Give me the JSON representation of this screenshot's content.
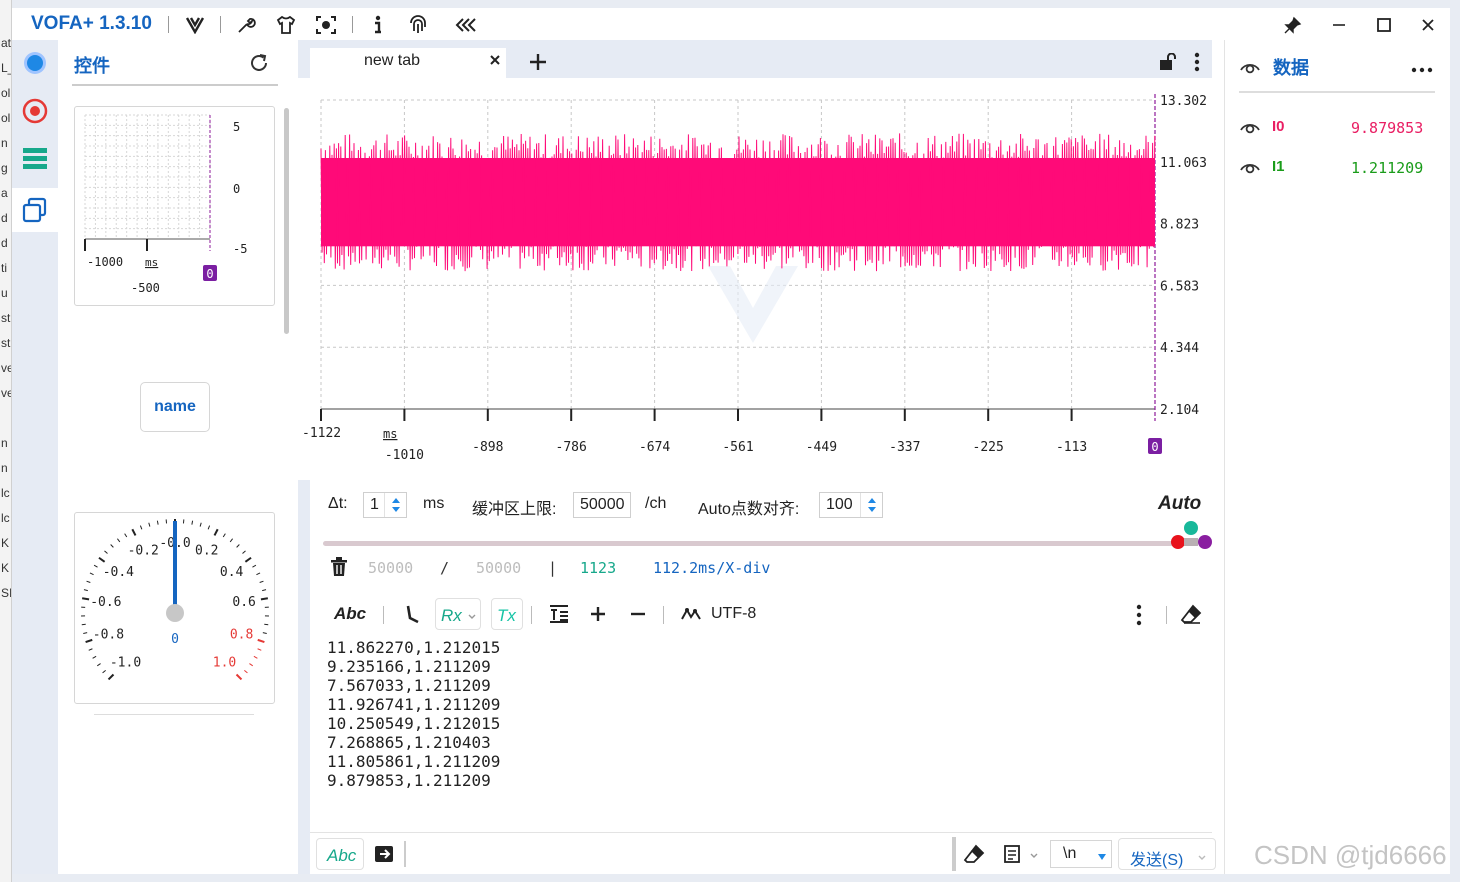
{
  "app": {
    "title": "VOFA+ 1.3.10"
  },
  "bg_left_letters": [
    "at",
    "L_",
    "oli",
    "oli",
    "n",
    "g",
    "a",
    "d",
    "d",
    "ti",
    "u",
    "st",
    "st",
    "ve",
    "ve",
    "",
    "n",
    "n",
    "lc",
    "lc",
    "K",
    "K",
    "SI"
  ],
  "control_panel": {
    "title": "控件",
    "mini_chart": {
      "y_ticks": [
        "5",
        "0",
        "-5"
      ],
      "x_labels": [
        "-1000",
        "ms",
        "-500"
      ],
      "badge": "0"
    },
    "name_button": "name",
    "gauge": {
      "labels": [
        "-0.2",
        "-0.0",
        "0.2",
        "-0.4",
        "0.4",
        "-0.6",
        "0.6",
        "-0.8",
        "0.8",
        "-1.0",
        "1.0"
      ],
      "value_label": "0",
      "value": 0.0,
      "min": -1.0,
      "max": 1.0,
      "danger_color": "#e53935"
    }
  },
  "tabs": [
    {
      "label": "new tab"
    }
  ],
  "chart_data": {
    "type": "line",
    "x_ticks": [
      "-1122",
      "-1010",
      "-898",
      "-786",
      "-674",
      "-561",
      "-449",
      "-337",
      "-225",
      "-113"
    ],
    "x_unit": "ms",
    "y_ticks": [
      "13.302",
      "11.063",
      "8.823",
      "6.583",
      "4.344",
      "2.104"
    ],
    "xlim": [
      -1122,
      0
    ],
    "ylim": [
      2.104,
      13.302
    ],
    "cursor_badge": "0",
    "series": [
      {
        "name": "I0",
        "color": "#ff0a78",
        "value_range": [
          7.1,
          12.1
        ]
      }
    ]
  },
  "settings": {
    "dt_label": "Δt:",
    "dt_value": "1",
    "dt_unit": "ms",
    "buffer_label": "缓冲区上限:",
    "buffer_value": "50000",
    "buffer_unit": "/ch",
    "auto_align_label": "Auto点数对齐:",
    "auto_align_value": "100",
    "auto_label": "Auto"
  },
  "counts": {
    "buffered": "50000",
    "slash": "/",
    "capacity": "50000",
    "sep": "|",
    "points": "1123",
    "div": "112.2ms/X-div"
  },
  "rx_toolbar": {
    "abc": "Abc",
    "rx": "Rx",
    "tx": "Tx",
    "encoding": "UTF-8"
  },
  "rx_lines": [
    "11.862270,1.212015",
    "9.235166,1.211209",
    "7.567033,1.211209",
    "11.926741,1.211209",
    "10.250549,1.212015",
    "7.268865,1.210403",
    "11.805861,1.211209",
    "9.879853,1.211209"
  ],
  "send_row": {
    "abc": "Abc",
    "line_ending": "\\n",
    "send_label": "发送(S)"
  },
  "data_panel": {
    "title": "数据",
    "channels": [
      {
        "name": "I0",
        "value": "9.879853",
        "color": "#e91e63"
      },
      {
        "name": "I1",
        "value": "1.211209",
        "color": "#1a9c1a"
      }
    ]
  },
  "watermark": "CSDN @tjd6666"
}
